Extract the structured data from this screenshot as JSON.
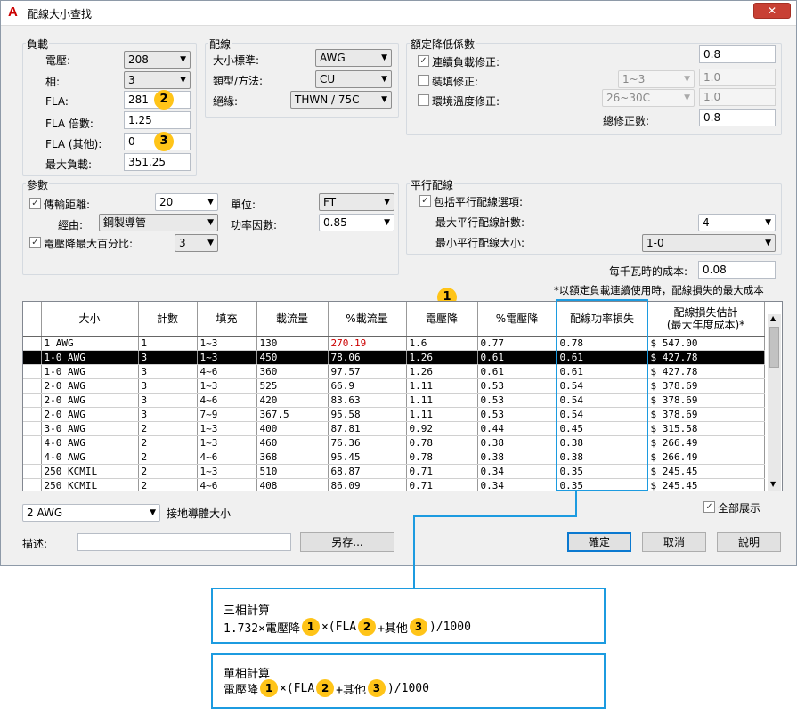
{
  "window": {
    "title": "配線大小查找",
    "logo": "A",
    "close": "✕"
  },
  "load": {
    "group": "負載",
    "voltage_label": "電壓:",
    "voltage": "208",
    "phase_label": "相:",
    "phase": "3",
    "fla_label": "FLA:",
    "fla": "281",
    "fla_mult_label": "FLA 倍數:",
    "fla_mult": "1.25",
    "fla_other_label": "FLA (其他):",
    "fla_other": "0",
    "max_load_label": "最大負載:",
    "max_load": "351.25"
  },
  "wiring": {
    "group": "配線",
    "size_std_label": "大小標準:",
    "size_std": "AWG",
    "type_label": "類型/方法:",
    "type": "CU",
    "insulation_label": "絕緣:",
    "insulation": "THWN / 75C"
  },
  "derating": {
    "group": "額定降低係數",
    "continuous_label": "連續負載修正:",
    "continuous_value": "0.8",
    "fill_label": "裝填修正:",
    "fill_select": "1~3",
    "fill_value": "1.0",
    "temp_label": "環境溫度修正:",
    "temp_select": "26~30C",
    "temp_value": "1.0",
    "total_label": "總修正數:",
    "total_value": "0.8"
  },
  "params": {
    "group": "參數",
    "distance_label": "傳輸距離:",
    "distance": "20",
    "unit_label": "單位:",
    "unit": "FT",
    "via_label": "經由:",
    "via": "鋼製導管",
    "pf_label": "功率因數:",
    "pf": "0.85",
    "vdrop_label": "電壓降最大百分比:",
    "vdrop": "3"
  },
  "parallel": {
    "group": "平行配線",
    "include_label": "包括平行配線選項:",
    "max_count_label": "最大平行配線計數:",
    "max_count": "4",
    "min_size_label": "最小平行配線大小:",
    "min_size": "1-0"
  },
  "cost": {
    "label": "每千瓦時的成本:",
    "value": "0.08",
    "note": "*以額定負載連續使用時，配線損失的最大成本"
  },
  "badges": {
    "one": "1",
    "two": "2",
    "three": "3"
  },
  "table": {
    "headers": [
      "大小",
      "計數",
      "填充",
      "載流量",
      "%載流量",
      "電壓降",
      "%電壓降",
      "配線功率損失",
      "配線損失估計\n(最大年度成本)*"
    ],
    "rows": [
      [
        "1 AWG",
        "1",
        "1~3",
        "130",
        "270.19",
        "1.6",
        "0.77",
        "0.78",
        "$ 547.00"
      ],
      [
        "1-0 AWG",
        "3",
        "1~3",
        "450",
        "78.06",
        "1.26",
        "0.61",
        "0.61",
        "$ 427.78"
      ],
      [
        "1-0 AWG",
        "3",
        "4~6",
        "360",
        "97.57",
        "1.26",
        "0.61",
        "0.61",
        "$ 427.78"
      ],
      [
        "2-0 AWG",
        "3",
        "1~3",
        "525",
        "66.9",
        "1.11",
        "0.53",
        "0.54",
        "$ 378.69"
      ],
      [
        "2-0 AWG",
        "3",
        "4~6",
        "420",
        "83.63",
        "1.11",
        "0.53",
        "0.54",
        "$ 378.69"
      ],
      [
        "2-0 AWG",
        "3",
        "7~9",
        "367.5",
        "95.58",
        "1.11",
        "0.53",
        "0.54",
        "$ 378.69"
      ],
      [
        "3-0 AWG",
        "2",
        "1~3",
        "400",
        "87.81",
        "0.92",
        "0.44",
        "0.45",
        "$ 315.58"
      ],
      [
        "4-0 AWG",
        "2",
        "1~3",
        "460",
        "76.36",
        "0.78",
        "0.38",
        "0.38",
        "$ 266.49"
      ],
      [
        "4-0 AWG",
        "2",
        "4~6",
        "368",
        "95.45",
        "0.78",
        "0.38",
        "0.38",
        "$ 266.49"
      ],
      [
        "250 KCMIL",
        "2",
        "1~3",
        "510",
        "68.87",
        "0.71",
        "0.34",
        "0.35",
        "$ 245.45"
      ],
      [
        "250 KCMIL",
        "2",
        "4~6",
        "408",
        "86.09",
        "0.71",
        "0.34",
        "0.35",
        "$ 245.45"
      ]
    ],
    "selected_row": 1
  },
  "footer": {
    "ground_size": "2 AWG",
    "ground_label": "接地導體大小",
    "show_all_label": "全部展示",
    "desc_label": "描述:",
    "desc_value": "",
    "saveas": "另存...",
    "ok": "確定",
    "cancel": "取消",
    "help": "說明"
  },
  "callout_three": {
    "title": "三相計算",
    "prefix": "1.732×電壓降",
    "times": "×(FLA",
    "plus": "+其他",
    "suffix": ")/1000"
  },
  "callout_single": {
    "title": "單相計算",
    "prefix": "電壓降",
    "times": "×(FLA",
    "plus": "+其他",
    "suffix": ")/1000"
  },
  "colors": {
    "accent": "#1c9be0",
    "badge": "#ffc418",
    "close": "#c84034",
    "over": "#cc0000"
  }
}
